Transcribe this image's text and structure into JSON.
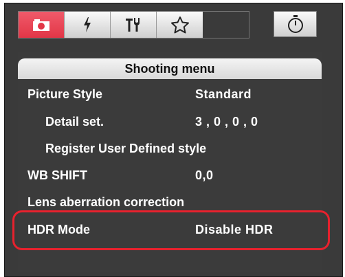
{
  "tabs": [
    {
      "icon": "camera-icon",
      "active": true
    },
    {
      "icon": "flash-icon",
      "active": false
    },
    {
      "icon": "tools-icon",
      "active": false
    },
    {
      "icon": "star-icon",
      "active": false
    }
  ],
  "timer_tab": {
    "icon": "timer-icon"
  },
  "menu": {
    "title": "Shooting menu",
    "items": [
      {
        "label": "Picture Style",
        "value": "Standard"
      },
      {
        "label": "Detail set.",
        "value": "3 , 0 , 0 , 0"
      },
      {
        "label": "Register User Defined style",
        "value": ""
      },
      {
        "label": "WB SHIFT",
        "value": "0,0"
      },
      {
        "label": "Lens aberration correction",
        "value": ""
      },
      {
        "label": "HDR Mode",
        "value": "Disable HDR"
      }
    ]
  },
  "colors": {
    "accent": "#e23647",
    "highlight": "#e8212d",
    "panel": "#3b3b3b"
  }
}
